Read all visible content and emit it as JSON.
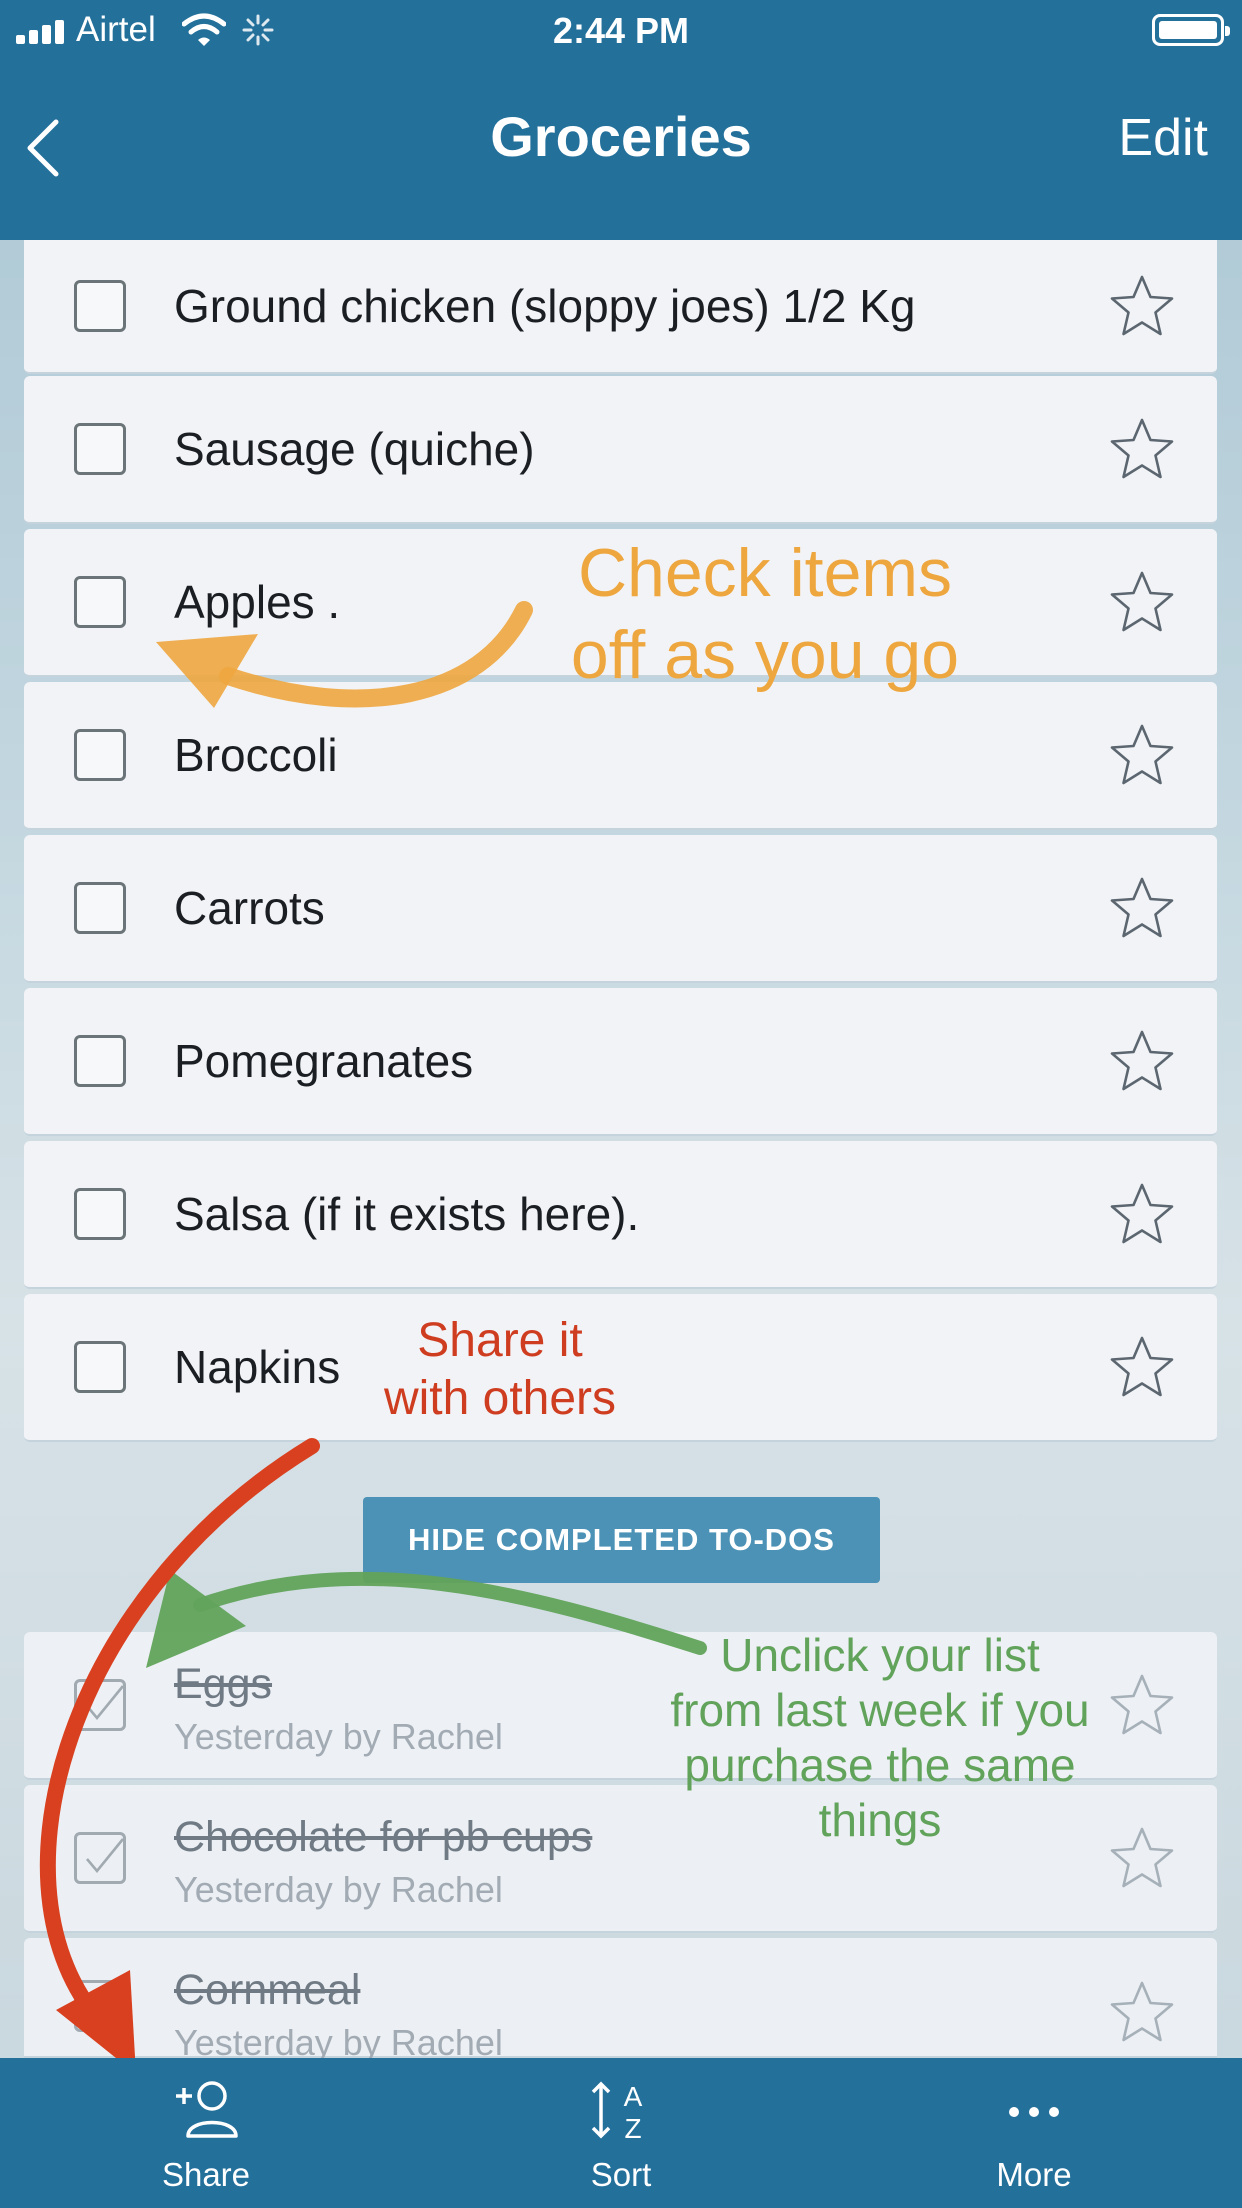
{
  "status_bar": {
    "carrier": "Airtel",
    "time": "2:44 PM",
    "icons": [
      "signal-icon",
      "wifi-icon",
      "activity-spinner-icon",
      "battery-icon"
    ]
  },
  "nav": {
    "title": "Groceries",
    "edit_label": "Edit",
    "back_icon": "chevron-left-icon"
  },
  "todos": [
    {
      "label": "Ground chicken (sloppy joes) 1/2 Kg",
      "checked": false
    },
    {
      "label": "Sausage (quiche)",
      "checked": false
    },
    {
      "label": "Apples .",
      "checked": false
    },
    {
      "label": "Broccoli",
      "checked": false
    },
    {
      "label": "Carrots",
      "checked": false
    },
    {
      "label": "Pomegranates",
      "checked": false
    },
    {
      "label": "Salsa (if it exists here).",
      "checked": false
    },
    {
      "label": "Napkins",
      "checked": false
    }
  ],
  "hide_completed_label": "HIDE COMPLETED TO-DOS",
  "completed": [
    {
      "label": "Eggs",
      "meta": "Yesterday by Rachel",
      "checked": true
    },
    {
      "label": "Chocolate for pb cups",
      "meta": "Yesterday by Rachel",
      "checked": true
    },
    {
      "label": "Cornmeal",
      "meta": "Yesterday by Rachel",
      "checked": true
    }
  ],
  "tab_bar": {
    "share_label": "Share",
    "sort_label": "Sort",
    "more_label": "More"
  },
  "annotations": {
    "orange_line1": "Check items",
    "orange_line2": "off as you go",
    "red_line1": "Share it",
    "red_line2": "with others",
    "green_line1": "Unclick your list",
    "green_line2": "from last week if you",
    "green_line3": "purchase the same",
    "green_line4": "things"
  },
  "colors": {
    "bar_blue": "#23709b",
    "button_blue": "#4b92b6",
    "orange_annotation": "#eea63f",
    "red_annotation": "#cf3d21",
    "green_annotation": "#62a35b"
  }
}
